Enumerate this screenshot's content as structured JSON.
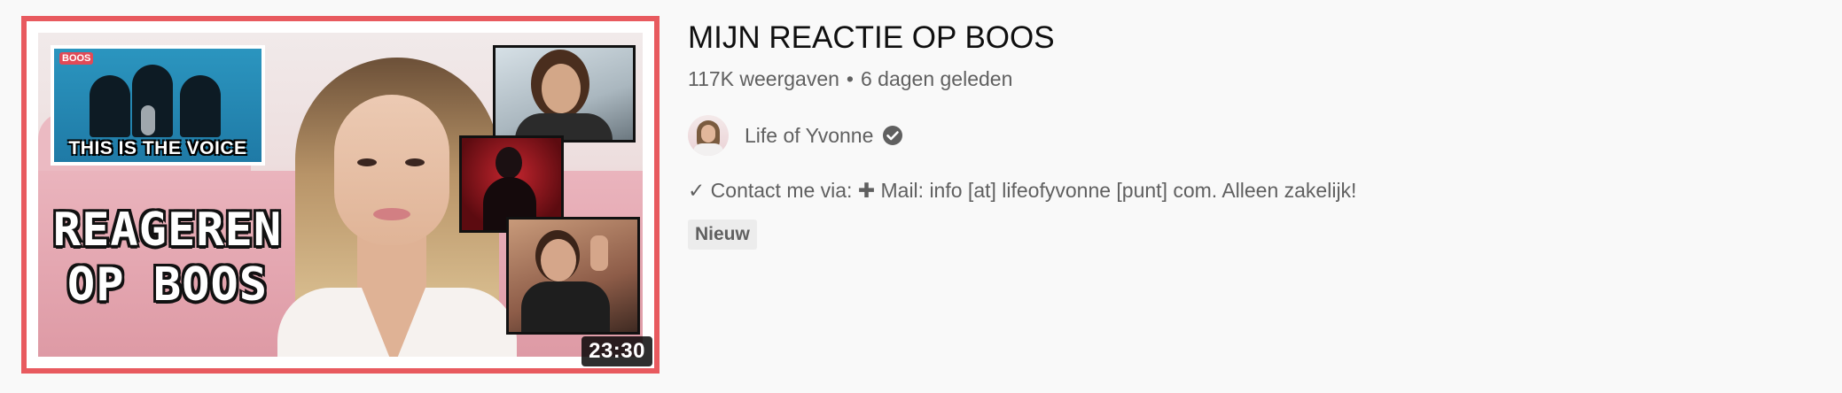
{
  "video": {
    "title": "MIJN REACTIE OP BOOS",
    "views": "117K weergaven",
    "separator": "•",
    "age": "6 dagen geleden",
    "duration": "23:30",
    "channel": {
      "name": "Life of Yvonne",
      "verified_icon": "verified-check-icon"
    },
    "description": "✓ Contact me via: ✚ Mail: info [at] lifeofyvonne [punt] com. Alleen zakelijk!",
    "badge": "Nieuw"
  },
  "thumbnail": {
    "inset_caption": "THIS IS THE VOICE",
    "inset_logo": "BOOS",
    "main_caption_line1": "REAGEREN",
    "main_caption_line2": "OP BOOS"
  },
  "colors": {
    "thumbnail_border": "#e85a5f",
    "title_text": "#0f0f0f",
    "secondary_text": "#606060",
    "page_background": "#f9f9f9"
  }
}
